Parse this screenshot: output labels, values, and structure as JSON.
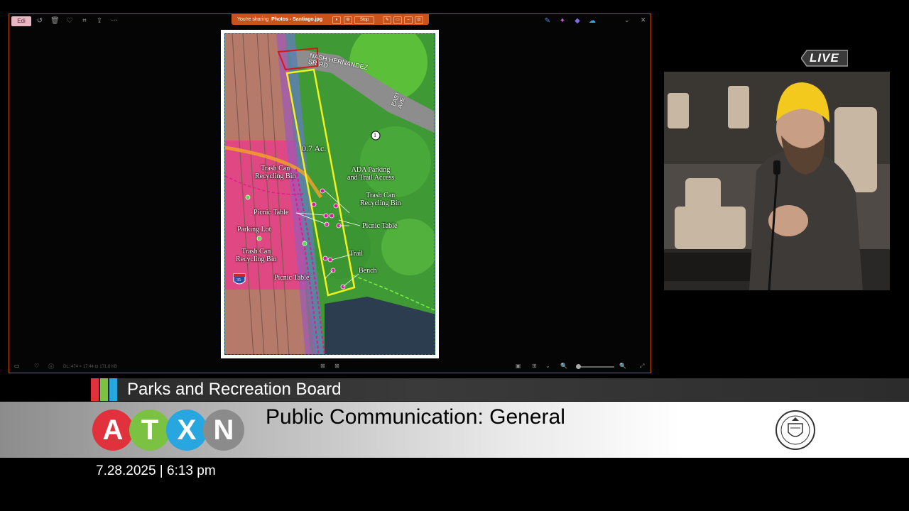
{
  "window": {
    "edit_label": "Edi",
    "sharing_prefix": "You're sharing",
    "sharing_app": "Photos - Santiago.jpg",
    "stop_label": "Stop",
    "status_info": "DL: 474 × 17:44   ⊡ 171.8 KB",
    "more_label": "···"
  },
  "map": {
    "road_label": "NASH HERNANDEZ\nSR RD",
    "east_ave_label": "EAST\nAVE",
    "area_label": "0.7 Ac.",
    "marker_number": "1",
    "interstate_label": "35",
    "labels": {
      "trash_can_1": "Trash Can\nRecycling Bin",
      "ada_parking": "ADA Parking\nand Trail Access",
      "trash_can_2": "Trash Can\nRecycling Bin",
      "picnic_table_1": "Picnic Table",
      "picnic_table_2": "Picnic Table",
      "parking_lot": "Parking Lot",
      "trash_can_3": "Trash Can\nRecycling Bin",
      "trail": "Trail",
      "picnic_table_3": "Picnic Table",
      "bench": "Bench"
    }
  },
  "live_badge": "LIVE",
  "lower_third": {
    "board": "Parks and Recreation Board",
    "headline": "Public Communication: General",
    "datetime": "7.28.2025 | 6:13 pm",
    "logo_letters": [
      "A",
      "T",
      "X",
      "N"
    ],
    "logo_colors": [
      "#e0313d",
      "#7cc242",
      "#27a6e0",
      "#8b8b8b"
    ],
    "stripe_colors": [
      "#e0313d",
      "#7cc242",
      "#27a6e0"
    ]
  }
}
